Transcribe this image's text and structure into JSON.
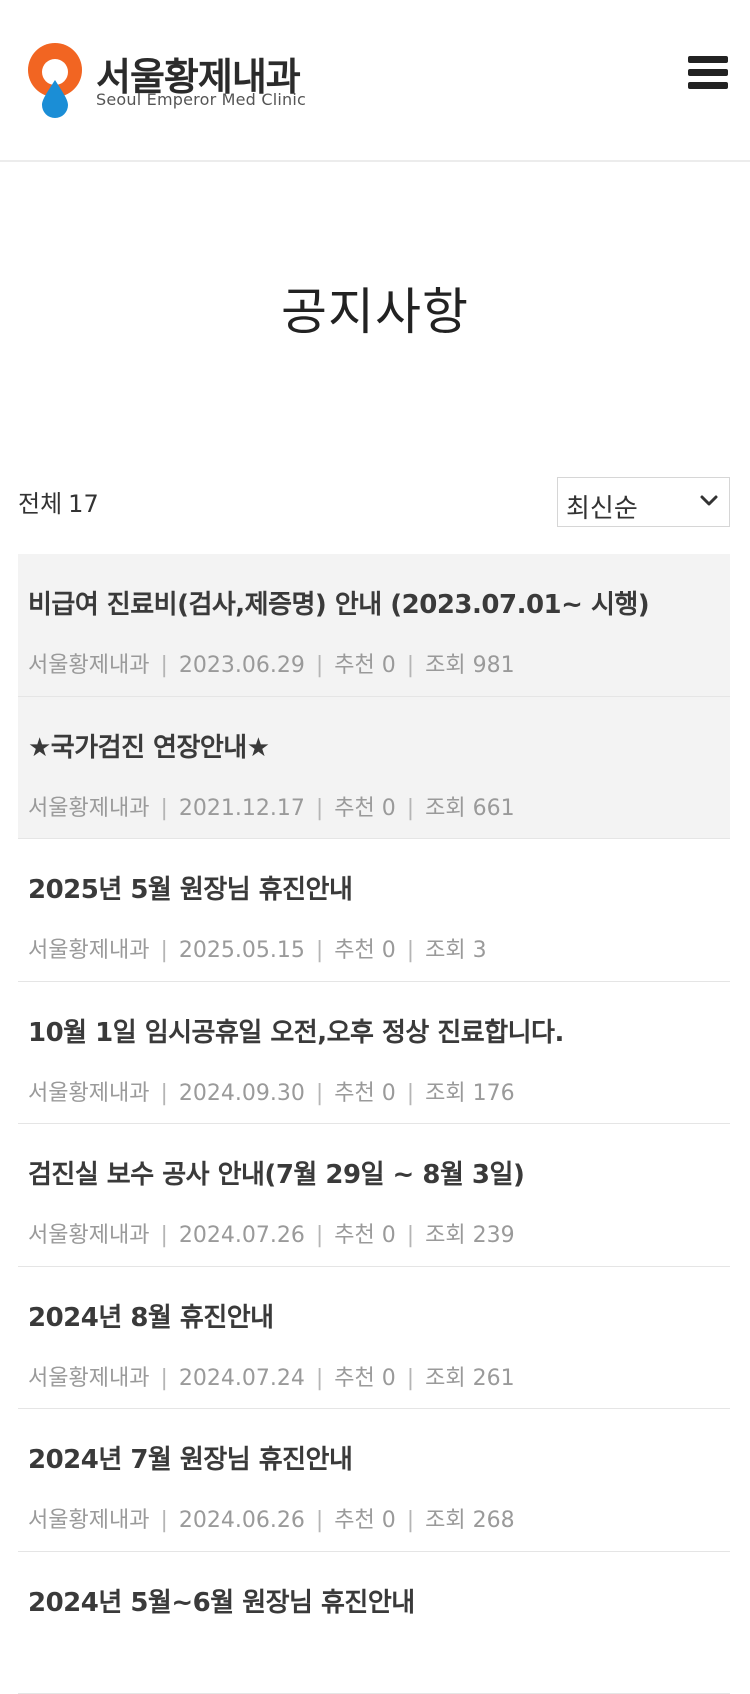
{
  "header": {
    "logo_kr": "서울황제내과",
    "logo_en": "Seoul Emperor Med Clinic"
  },
  "page": {
    "title": "공지사항"
  },
  "toolbar": {
    "total_label": "전체",
    "total_count": "17",
    "sort_selected": "최신순"
  },
  "posts": [
    {
      "title": "비급여 진료비(검사,제증명) 안내 (2023.07.01~ 시행)",
      "author": "서울황제내과",
      "date": "2023.06.29",
      "recommend": "추천 0",
      "views": "조회 981",
      "pinned": true
    },
    {
      "title": "★국가검진 연장안내★",
      "author": "서울황제내과",
      "date": "2021.12.17",
      "recommend": "추천 0",
      "views": "조회 661",
      "pinned": true
    },
    {
      "title": "2025년 5월 원장님 휴진안내",
      "author": "서울황제내과",
      "date": "2025.05.15",
      "recommend": "추천 0",
      "views": "조회 3",
      "pinned": false
    },
    {
      "title": "10월 1일 임시공휴일 오전,오후 정상 진료합니다.",
      "author": "서울황제내과",
      "date": "2024.09.30",
      "recommend": "추천 0",
      "views": "조회 176",
      "pinned": false
    },
    {
      "title": "검진실 보수 공사 안내(7월 29일 ~ 8월 3일)",
      "author": "서울황제내과",
      "date": "2024.07.26",
      "recommend": "추천 0",
      "views": "조회 239",
      "pinned": false
    },
    {
      "title": "2024년 8월 휴진안내",
      "author": "서울황제내과",
      "date": "2024.07.24",
      "recommend": "추천 0",
      "views": "조회 261",
      "pinned": false
    },
    {
      "title": "2024년 7월 원장님 휴진안내",
      "author": "서울황제내과",
      "date": "2024.06.26",
      "recommend": "추천 0",
      "views": "조회 268",
      "pinned": false
    },
    {
      "title": "2024년 5월~6월 원장님 휴진안내",
      "author": "",
      "date": "",
      "recommend": "",
      "views": "",
      "pinned": false
    }
  ],
  "colors": {
    "logo_orange": "#f26522",
    "logo_blue": "#1b8ed6",
    "pinned_bg": "#f3f3f3"
  }
}
